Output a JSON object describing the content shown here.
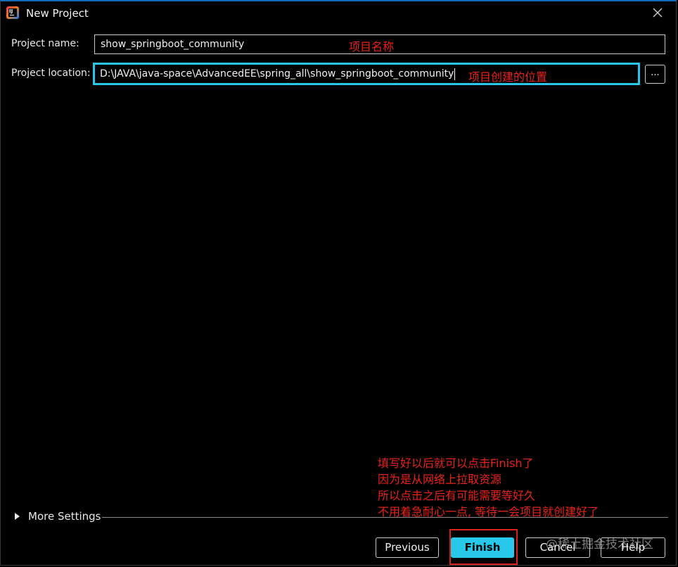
{
  "window": {
    "title": "New Project",
    "accent_color": "#28c6e8",
    "annotation_color": "#e8231a"
  },
  "form": {
    "name_label": "Project name:",
    "name_value": "show_springboot_community",
    "location_label": "Project location:",
    "location_value": "D:\\JAVA\\java-space\\AdvancedEE\\spring_all\\show_springboot_community",
    "browse_label": "..."
  },
  "annotations": {
    "name_note": "项目名称",
    "location_note": "项目创建的位置",
    "finish_note_lines": [
      "填写好以后就可以点击Finish了",
      "因为是从网络上拉取资源",
      "所以点击之后有可能需要等好久",
      "不用着急耐心一点, 等待一会项目就创建好了"
    ]
  },
  "more_settings": {
    "label": "More Settings"
  },
  "buttons": {
    "previous": "Previous",
    "finish": "Finish",
    "cancel": "Cancel",
    "help": "Help"
  },
  "watermark": "@稀土掘金技术社区",
  "icons": {
    "app": "intellij-idea-icon",
    "close": "close-icon",
    "expand": "triangle-right-icon"
  }
}
